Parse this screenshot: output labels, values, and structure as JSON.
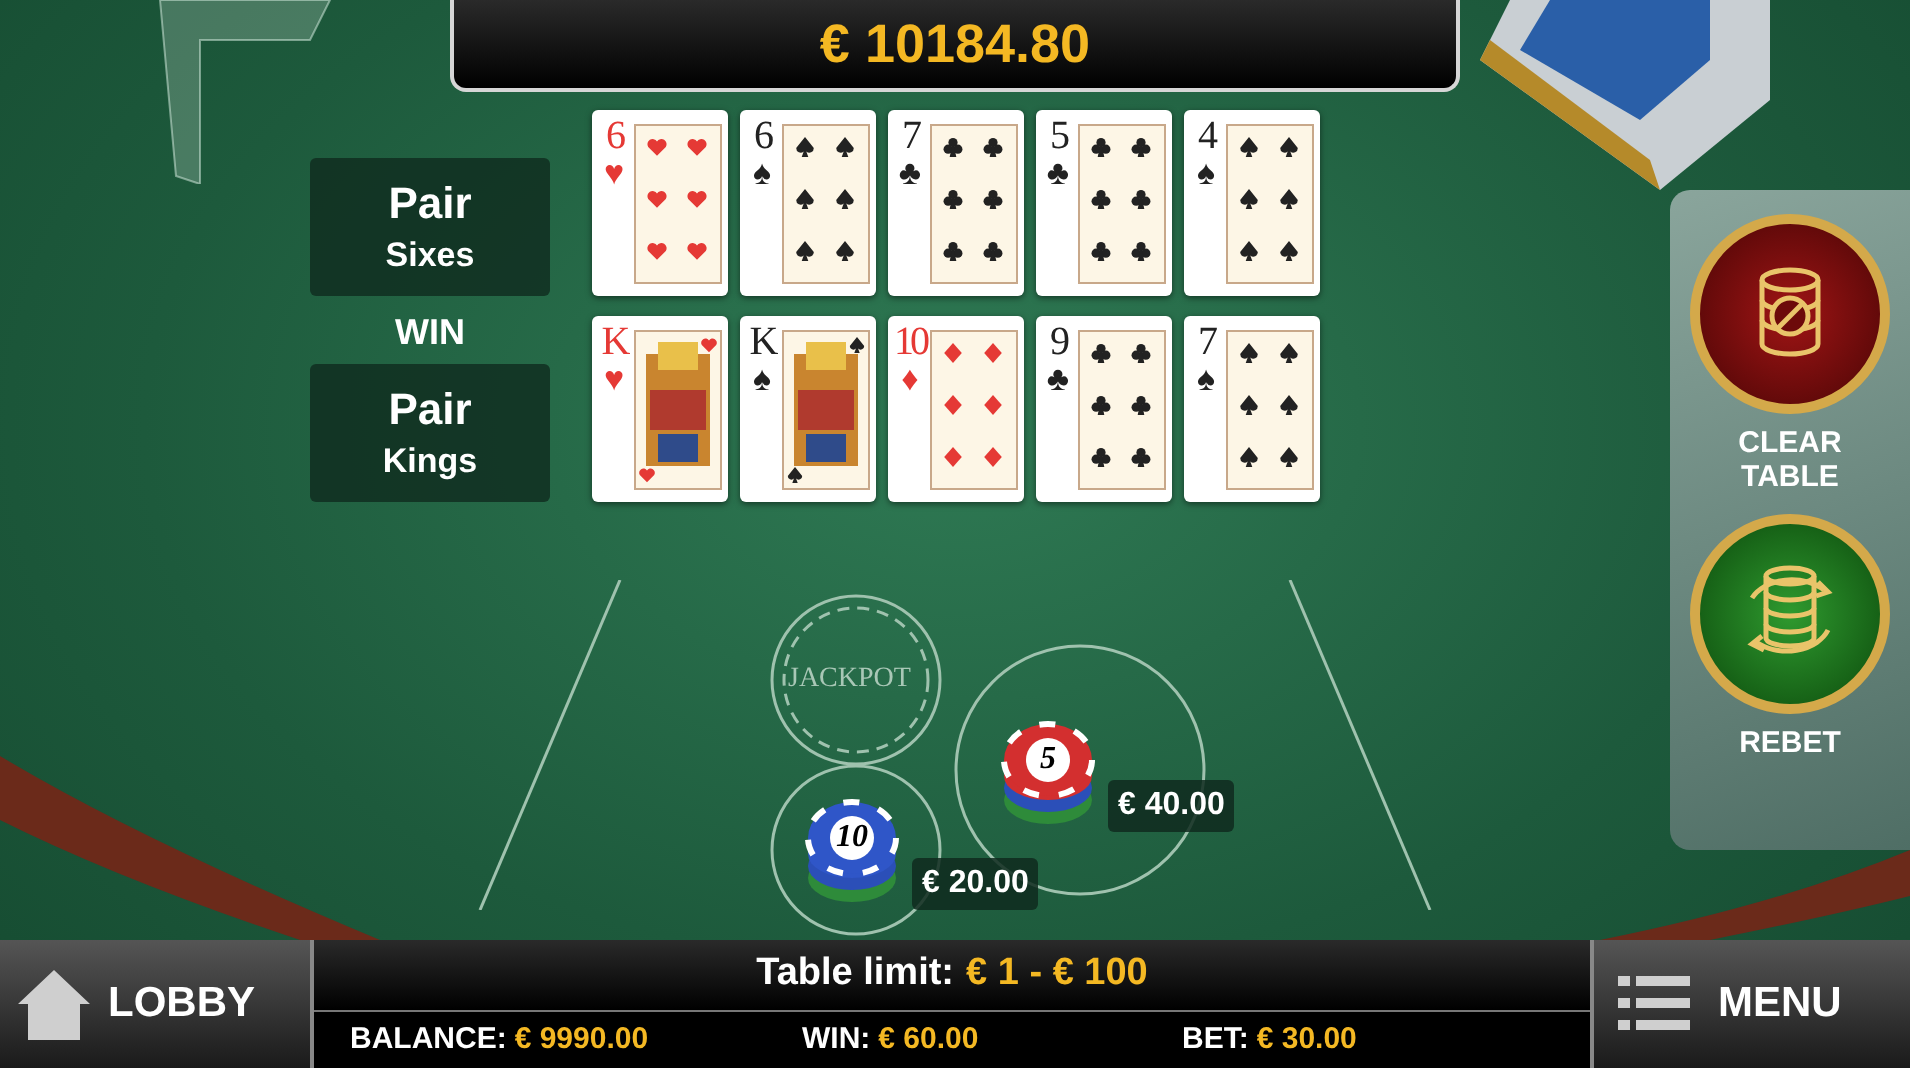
{
  "balance_display": "€ 10184.80",
  "hands": [
    {
      "title": "Pair",
      "subtitle": "Sixes",
      "cards": [
        {
          "rank": "6",
          "suit_symbol": "♥",
          "kind": "hearts",
          "face_card": false,
          "color": "#e53935"
        },
        {
          "rank": "6",
          "suit_symbol": "♠",
          "kind": "spades",
          "face_card": false,
          "color": "#222222"
        },
        {
          "rank": "7",
          "suit_symbol": "♣",
          "kind": "clubs",
          "face_card": false,
          "color": "#222222"
        },
        {
          "rank": "5",
          "suit_symbol": "♣",
          "kind": "clubs",
          "face_card": false,
          "color": "#222222"
        },
        {
          "rank": "4",
          "suit_symbol": "♠",
          "kind": "spades",
          "face_card": false,
          "color": "#222222"
        }
      ]
    },
    {
      "badge": "WIN",
      "title": "Pair",
      "subtitle": "Kings",
      "cards": [
        {
          "rank": "K",
          "suit_symbol": "♥",
          "kind": "hearts",
          "face_card": true,
          "color": "#e53935"
        },
        {
          "rank": "K",
          "suit_symbol": "♠",
          "kind": "spades",
          "face_card": true,
          "color": "#222222"
        },
        {
          "rank": "10",
          "suit_symbol": "♦",
          "kind": "diamonds",
          "face_card": false,
          "color": "#e53935"
        },
        {
          "rank": "9",
          "suit_symbol": "♣",
          "kind": "clubs",
          "face_card": false,
          "color": "#222222"
        },
        {
          "rank": "7",
          "suit_symbol": "♠",
          "kind": "spades",
          "face_card": false,
          "color": "#222222"
        }
      ]
    }
  ],
  "table_spots": [
    {
      "label": "JACKPOT"
    }
  ],
  "chips": [
    {
      "denomination": "5",
      "color": "#d32f2f",
      "amount": "€ 40.00"
    },
    {
      "denomination": "10",
      "color": "#2f56c8",
      "amount": "€ 20.00"
    }
  ],
  "side_buttons": [
    {
      "label": "CLEAR TABLE",
      "kind": "clear"
    },
    {
      "label": "REBET",
      "kind": "rebet"
    }
  ],
  "bottom_bar": {
    "lobby": "LOBBY",
    "table_limit_label": "Table limit:",
    "table_limit_value": "€ 1 - € 100",
    "stats": [
      {
        "label": "BALANCE:",
        "value": "€ 9990.00"
      },
      {
        "label": "WIN:",
        "value": "€ 60.00"
      },
      {
        "label": "BET:",
        "value": "€ 30.00"
      }
    ],
    "menu": "MENU"
  }
}
